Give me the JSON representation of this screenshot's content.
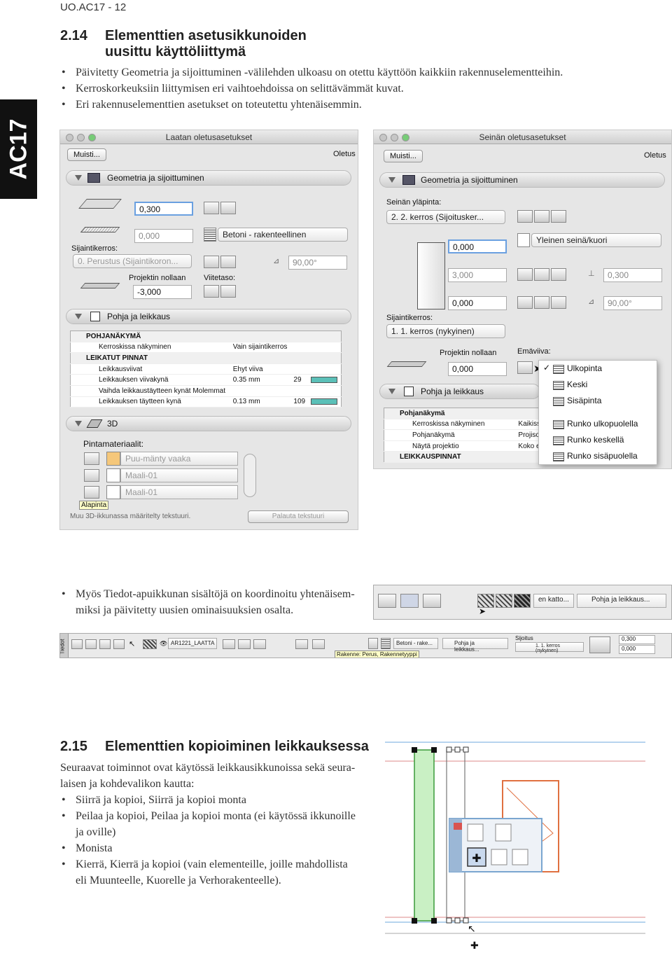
{
  "header": "UO.AC17 - 12",
  "side_tab": "AC17",
  "section1": {
    "number": "2.14",
    "title_line1": "Elementtien asetusikkunoiden",
    "title_line2": "uusittu käyttöliittymä",
    "bullets": [
      "Päivitetty Geometria ja sijoittuminen -välilehden ulkoasu on otettu käyttöön kaikkiin rakennuselementteihin.",
      "Kerroskorkeuksiin liittymisen eri vaihtoehdoissa on selittävämmät kuvat.",
      "Eri rakennuselementtien asetukset on toteutettu yhtenäisemmin."
    ]
  },
  "dialog_slab": {
    "title": "Laatan oletusasetukset",
    "memory_button": "Muisti...",
    "default_label": "Oletus",
    "section_geometry": "Geometria ja sijoittuminen",
    "thickness": "0,300",
    "offset": "0,000",
    "home_story_label": "Sijaintikerros:",
    "home_story_value": "0. Perustus (Sijaintikoron...",
    "projection_label": "Projektin nollaan",
    "projection_value": "-3,000",
    "material": "Betoni - rakenteellinen",
    "angle": "90,00°",
    "reference_label": "Viitetaso:",
    "section_plan": "Pohja ja leikkaus",
    "plan_rows": [
      {
        "group": true,
        "name": "POHJANÄKYMÄ",
        "value": "",
        "num": ""
      },
      {
        "group": false,
        "name": "Kerroskissa näkyminen",
        "value": "Vain sijaintikerros",
        "num": ""
      },
      {
        "group": true,
        "name": "LEIKATUT PINNAT",
        "value": "",
        "num": ""
      },
      {
        "group": false,
        "name": "Leikkausviivat",
        "value": "Ehyt viiva",
        "num": ""
      },
      {
        "group": false,
        "name": "Leikkauksen viivakynä",
        "value": "0.35 mm",
        "num": "29"
      },
      {
        "group": false,
        "name": "Vaihda leikkaustäytteen kynät Molemmat",
        "value": "",
        "num": ""
      },
      {
        "group": false,
        "name": "Leikkauksen täytteen kynä",
        "value": "0.13 mm",
        "num": "109"
      }
    ],
    "section_3d": "3D",
    "surface_label": "Pintamateriaalit:",
    "surfaces": [
      "Puu-mänty vaaka",
      "Maali-01",
      "Maali-01"
    ],
    "tooltip": "Alapinta",
    "footer_note": "Muu 3D-ikkunassa määritelty tekstuuri.",
    "reset_button": "Palauta tekstuuri"
  },
  "dialog_wall": {
    "title": "Seinän oletusasetukset",
    "memory_button": "Muisti...",
    "default_label": "Oletus",
    "section_geometry": "Geometria ja sijoittuminen",
    "top_label": "Seinän yläpinta:",
    "top_value": "2. 2. kerros (Sijoitusker...",
    "material": "Yleinen seinä/kuori",
    "height": "0,000",
    "thickness": "3,000",
    "thickness2": "0,300",
    "offset": "0,000",
    "angle": "90,00°",
    "home_story_label": "Sijaintikerros:",
    "home_story_value": "1. 1. kerros (nykyinen)",
    "projection_label": "Projektin nollaan",
    "projection_value": "0,000",
    "reference_label": "Emäviiva:",
    "menu_items": [
      "Ulkopinta",
      "Keski",
      "Sisäpinta",
      "Runko ulkopuolella",
      "Runko keskellä",
      "Runko sisäpuolella"
    ],
    "section_plan": "Pohja ja leikkaus",
    "plan_rows": [
      {
        "group": true,
        "name": "Pohjanäkymä",
        "value": ""
      },
      {
        "group": false,
        "name": "Kerroskissa näkyminen",
        "value": "Kaikiss"
      },
      {
        "group": false,
        "name": "Pohjanäkymä",
        "value": "Projiso"
      },
      {
        "group": false,
        "name": "Näytä projektio",
        "value": "Koko e"
      },
      {
        "group": true,
        "name": "LEIKKAUSPINNAT",
        "value": ""
      }
    ]
  },
  "bullet_info": "Myös Tiedot-apuikkunan sisältöjä on koordinoitu yhtenäisem-miksi ja päivitetty uusien ominaisuuksien osalta.",
  "info_snippet": {
    "item1": "en katto...",
    "item2": "Pohja ja leikkaus..."
  },
  "info_bar": {
    "tab": "Tiedot",
    "layer": "AR1221_LAATTA",
    "material": "Betoni - rake...",
    "plan": "Pohja ja leikkaus...",
    "placement_label": "Sijoitus",
    "story": "1. 1. kerros (nykyinen)",
    "val1": "0,300",
    "val2": "0,000",
    "structure": "Rakenne: Perus, Rakennetyyppi"
  },
  "section2": {
    "number": "2.15",
    "title": "Elementtien kopioiminen leikkauksessa",
    "intro": "Seuraavat toiminnot ovat käytössä leikkausikkunoissa sekä seura-laisen ja kohdevalikon kautta:",
    "bullets": [
      "Siirrä ja kopioi, Siirrä ja kopioi monta",
      "Peilaa ja kopioi, Peilaa ja kopioi monta (ei käytössä ikkunoille ja oville)",
      "Monista",
      "Kierrä, Kierrä ja kopioi (vain elementeille, joille mahdollista eli Muunteelle, Kuorelle ja Verhorakenteelle)."
    ]
  },
  "colors": {
    "tab_bg": "#111111",
    "wall_green": "#c9f0c4",
    "accent_blue": "#6aa0e0",
    "swatch": "#5bc0b8"
  }
}
